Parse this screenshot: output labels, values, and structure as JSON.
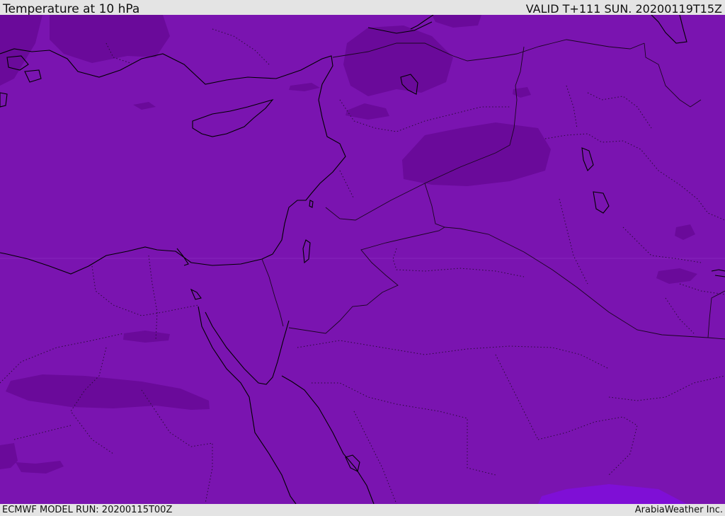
{
  "header": {
    "title": "Temperature at 10 hPa",
    "valid": "VALID T+111 SUN. 20200119T15Z"
  },
  "footer": {
    "model_run": "ECMWF MODEL RUN: 20200115T00Z",
    "credit": "ArabiaWeather Inc."
  },
  "map": {
    "field": "temperature",
    "colors": {
      "base_fill": "#7a14b0",
      "darker_patch": "#6a0a9a",
      "lighter_patch": "#7f0fd6",
      "coastline": "#000000",
      "border_line": "#2a0a3a"
    }
  }
}
